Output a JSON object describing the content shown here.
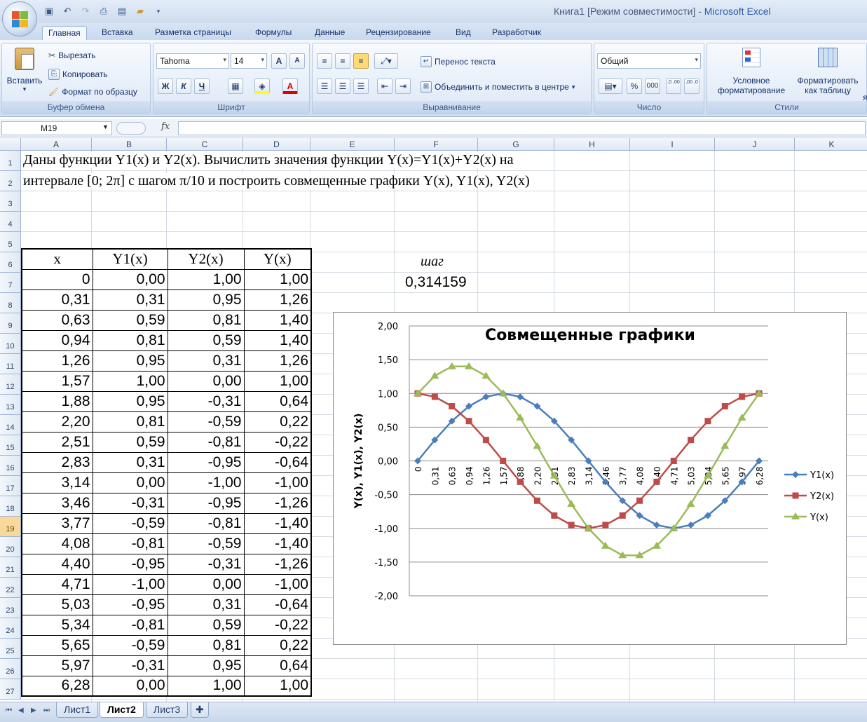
{
  "window": {
    "title": "Книга1  [Режим совместимости] - ",
    "app": "Microsoft Excel"
  },
  "qat": {
    "icons": [
      "save-icon",
      "undo-icon",
      "redo-icon",
      "print-preview-icon",
      "layout-icon",
      "open-icon",
      "customize-qat-icon"
    ]
  },
  "ribbon": {
    "tabs": [
      "Главная",
      "Вставка",
      "Разметка страницы",
      "Формулы",
      "Данные",
      "Рецензирование",
      "Вид",
      "Разработчик"
    ],
    "active_tab": "Главная",
    "clipboard": {
      "label": "Буфер обмена",
      "paste": "Вставить",
      "cut": "Вырезать",
      "copy": "Копировать",
      "format_painter": "Формат по образцу"
    },
    "font": {
      "label": "Шрифт",
      "font_name": "Tahoma",
      "font_size": "14",
      "grow": "A",
      "shrink": "A",
      "bold": "Ж",
      "italic": "К",
      "underline": "Ч"
    },
    "alignment": {
      "label": "Выравнивание",
      "wrap": "Перенос текста",
      "merge": "Объединить и поместить в центре"
    },
    "number": {
      "label": "Число",
      "format": "Общий",
      "percent": "%",
      "thousands": "000",
      "inc_decimal": ",0 ,00",
      "dec_decimal": ",00 ,0"
    },
    "styles": {
      "label": "Стили",
      "conditional_line1": "Условное",
      "conditional_line2": "форматирование",
      "table_line1": "Форматировать",
      "table_line2": "как таблицу",
      "cell_styles": "я"
    }
  },
  "formula_bar": {
    "cell_ref": "M19",
    "fx": "fx",
    "formula": ""
  },
  "columns": [
    "A",
    "B",
    "C",
    "D",
    "E",
    "F",
    "G",
    "H",
    "I",
    "J",
    "K"
  ],
  "rows": [
    "1",
    "2",
    "3",
    "4",
    "5",
    "6",
    "7",
    "8",
    "9",
    "10",
    "11",
    "12",
    "13",
    "14",
    "15",
    "16",
    "17",
    "18",
    "19",
    "20",
    "21",
    "22",
    "23",
    "24",
    "25",
    "26",
    "27"
  ],
  "selected_row": "19",
  "task": {
    "line1": "Даны функции Y1(x) и Y2(x). Вычислить значения функции Y(x)=Y1(x)+Y2(x) на",
    "line2": "интервале [0; 2π] с шагом π/10 и построить совмещенные графики Y(x), Y1(x), Y2(x)"
  },
  "table": {
    "headers": [
      "x",
      "Y1(x)",
      "Y2(x)",
      "Y(x)"
    ],
    "rows": [
      [
        "0",
        "0,00",
        "1,00",
        "1,00"
      ],
      [
        "0,31",
        "0,31",
        "0,95",
        "1,26"
      ],
      [
        "0,63",
        "0,59",
        "0,81",
        "1,40"
      ],
      [
        "0,94",
        "0,81",
        "0,59",
        "1,40"
      ],
      [
        "1,26",
        "0,95",
        "0,31",
        "1,26"
      ],
      [
        "1,57",
        "1,00",
        "0,00",
        "1,00"
      ],
      [
        "1,88",
        "0,95",
        "-0,31",
        "0,64"
      ],
      [
        "2,20",
        "0,81",
        "-0,59",
        "0,22"
      ],
      [
        "2,51",
        "0,59",
        "-0,81",
        "-0,22"
      ],
      [
        "2,83",
        "0,31",
        "-0,95",
        "-0,64"
      ],
      [
        "3,14",
        "0,00",
        "-1,00",
        "-1,00"
      ],
      [
        "3,46",
        "-0,31",
        "-0,95",
        "-1,26"
      ],
      [
        "3,77",
        "-0,59",
        "-0,81",
        "-1,40"
      ],
      [
        "4,08",
        "-0,81",
        "-0,59",
        "-1,40"
      ],
      [
        "4,40",
        "-0,95",
        "-0,31",
        "-1,26"
      ],
      [
        "4,71",
        "-1,00",
        "0,00",
        "-1,00"
      ],
      [
        "5,03",
        "-0,95",
        "0,31",
        "-0,64"
      ],
      [
        "5,34",
        "-0,81",
        "0,59",
        "-0,22"
      ],
      [
        "5,65",
        "-0,59",
        "0,81",
        "0,22"
      ],
      [
        "5,97",
        "-0,31",
        "0,95",
        "0,64"
      ],
      [
        "6,28",
        "0,00",
        "1,00",
        "1,00"
      ]
    ]
  },
  "step": {
    "label": "шаг",
    "value": "0,314159"
  },
  "chart_data": {
    "type": "line",
    "title": "Совмещенные графики",
    "xlabel": "",
    "ylabel": "Y(x), Y1(x), Y2(x)",
    "categories": [
      "0",
      "0,31",
      "0,63",
      "0,94",
      "1,26",
      "1,57",
      "1,88",
      "2,20",
      "2,51",
      "2,83",
      "3,14",
      "3,46",
      "3,77",
      "4,08",
      "4,40",
      "4,71",
      "5,03",
      "5,34",
      "5,65",
      "5,97",
      "6,28"
    ],
    "ylim": [
      -2,
      2
    ],
    "yticks": [
      "2,00",
      "1,50",
      "1,00",
      "0,50",
      "0,00",
      "-0,50",
      "-1,00",
      "-1,50",
      "-2,00"
    ],
    "grid": true,
    "legend": "right",
    "series": [
      {
        "name": "Y1(x)",
        "color": "#4a7ebb",
        "marker": "diamond",
        "values": [
          0,
          0.31,
          0.59,
          0.81,
          0.95,
          1.0,
          0.95,
          0.81,
          0.59,
          0.31,
          0,
          -0.31,
          -0.59,
          -0.81,
          -0.95,
          -1.0,
          -0.95,
          -0.81,
          -0.59,
          -0.31,
          0
        ]
      },
      {
        "name": "Y2(x)",
        "color": "#be4b48",
        "marker": "square",
        "values": [
          1.0,
          0.95,
          0.81,
          0.59,
          0.31,
          0,
          -0.31,
          -0.59,
          -0.81,
          -0.95,
          -1.0,
          -0.95,
          -0.81,
          -0.59,
          -0.31,
          0,
          0.31,
          0.59,
          0.81,
          0.95,
          1.0
        ]
      },
      {
        "name": "Y(x)",
        "color": "#9bbb59",
        "marker": "triangle",
        "values": [
          1.0,
          1.26,
          1.4,
          1.4,
          1.26,
          1.0,
          0.64,
          0.22,
          -0.22,
          -0.64,
          -1.0,
          -1.26,
          -1.4,
          -1.4,
          -1.26,
          -1.0,
          -0.64,
          -0.22,
          0.22,
          0.64,
          1.0
        ]
      }
    ]
  },
  "sheets": [
    "Лист1",
    "Лист2",
    "Лист3"
  ],
  "active_sheet": "Лист2"
}
